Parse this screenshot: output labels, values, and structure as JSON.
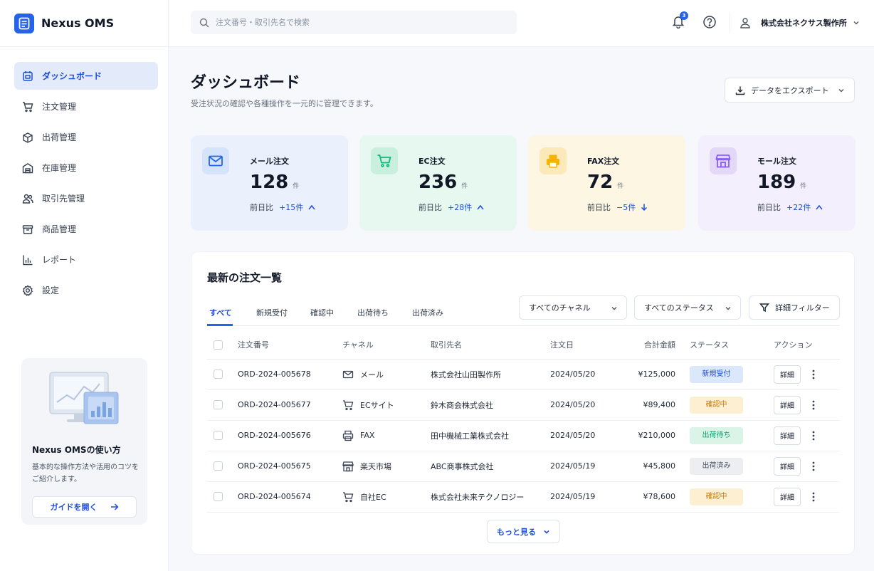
{
  "brand": {
    "name": "Nexus OMS"
  },
  "search": {
    "placeholder": "注文番号・取引先名で検索"
  },
  "header": {
    "notification_count": "3",
    "user_name": "株式会社ネクサス製作所"
  },
  "sidebar": {
    "items": [
      {
        "label": "ダッシュボード",
        "icon": "dashboard-icon"
      },
      {
        "label": "注文管理",
        "icon": "cart-icon"
      },
      {
        "label": "出荷管理",
        "icon": "shipping-box-icon"
      },
      {
        "label": "在庫管理",
        "icon": "warehouse-icon"
      },
      {
        "label": "取引先管理",
        "icon": "users-icon"
      },
      {
        "label": "商品管理",
        "icon": "product-box-icon"
      },
      {
        "label": "レポート",
        "icon": "chart-icon"
      },
      {
        "label": "設定",
        "icon": "gear-icon"
      }
    ],
    "guide": {
      "title": "Nexus OMSの使い方",
      "description": "基本的な操作方法や活用のコツをご紹介します。",
      "button": "ガイドを開く"
    }
  },
  "page": {
    "title": "ダッシュボード",
    "subtitle": "受注状況の確認や各種操作を一元的に管理できます。",
    "export_label": "データをエクスポート"
  },
  "stats": [
    {
      "label": "メール注文",
      "value": "128",
      "unit": "件",
      "delta_label": "前日比",
      "delta": "+15件",
      "direction": "up",
      "icon": "mail-icon",
      "bg": "#eaf1fd",
      "icon_bg": "#d6e4fb",
      "icon_color": "#2563eb"
    },
    {
      "label": "EC注文",
      "value": "236",
      "unit": "件",
      "delta_label": "前日比",
      "delta": "+28件",
      "direction": "up",
      "icon": "cart-icon",
      "bg": "#e7f8f1",
      "icon_bg": "#c9efdf",
      "icon_color": "#10b981"
    },
    {
      "label": "FAX注文",
      "value": "72",
      "unit": "件",
      "delta_label": "前日比",
      "delta": "−5件",
      "direction": "down",
      "icon": "fax-icon",
      "bg": "#fdf6e3",
      "icon_bg": "#fbe9b9",
      "icon_color": "#f5b400"
    },
    {
      "label": "モール注文",
      "value": "189",
      "unit": "件",
      "delta_label": "前日比",
      "delta": "+22件",
      "direction": "up",
      "icon": "store-icon",
      "bg": "#f3effc",
      "icon_bg": "#e3d8f8",
      "icon_color": "#8b5cf6"
    }
  ],
  "orders": {
    "title": "最新の注文一覧",
    "tabs": [
      "すべて",
      "新規受付",
      "確認中",
      "出荷待ち",
      "出荷済み"
    ],
    "channel_filter": "すべてのチャネル",
    "status_filter": "すべてのステータス",
    "detail_filter": "詳細フィルター",
    "columns": [
      "注文番号",
      "チャネル",
      "取引先名",
      "注文日",
      "合計金額",
      "ステータス",
      "アクション"
    ],
    "rows": [
      {
        "id": "ORD-2024-005678",
        "channel": "メール",
        "channel_icon": "mail-icon",
        "customer": "株式会社山田製作所",
        "date": "2024/05/20",
        "amount": "¥125,000",
        "status": "新規受付",
        "status_type": "new"
      },
      {
        "id": "ORD-2024-005677",
        "channel": "ECサイト",
        "channel_icon": "cart-icon",
        "customer": "鈴木商会株式会社",
        "date": "2024/05/20",
        "amount": "¥89,400",
        "status": "確認中",
        "status_type": "review"
      },
      {
        "id": "ORD-2024-005676",
        "channel": "FAX",
        "channel_icon": "fax-icon",
        "customer": "田中機械工業株式会社",
        "date": "2024/05/20",
        "amount": "¥210,000",
        "status": "出荷待ち",
        "status_type": "waiting"
      },
      {
        "id": "ORD-2024-005675",
        "channel": "楽天市場",
        "channel_icon": "store-icon",
        "customer": "ABC商事株式会社",
        "date": "2024/05/19",
        "amount": "¥45,800",
        "status": "出荷済み",
        "status_type": "shipped"
      },
      {
        "id": "ORD-2024-005674",
        "channel": "自社EC",
        "channel_icon": "cart-icon",
        "customer": "株式会社未来テクノロジー",
        "date": "2024/05/19",
        "amount": "¥78,600",
        "status": "確認中",
        "status_type": "review"
      }
    ],
    "detail_label": "詳細",
    "more_label": "もっと見る"
  },
  "status_colors": {
    "new": {
      "bg": "#dbe7fb",
      "fg": "#1d4ed8"
    },
    "review": {
      "bg": "#fdf0d2",
      "fg": "#c27c0e"
    },
    "waiting": {
      "bg": "#daf4e8",
      "fg": "#0f9f6e"
    },
    "shipped": {
      "bg": "#eceef2",
      "fg": "#4b5563"
    }
  }
}
